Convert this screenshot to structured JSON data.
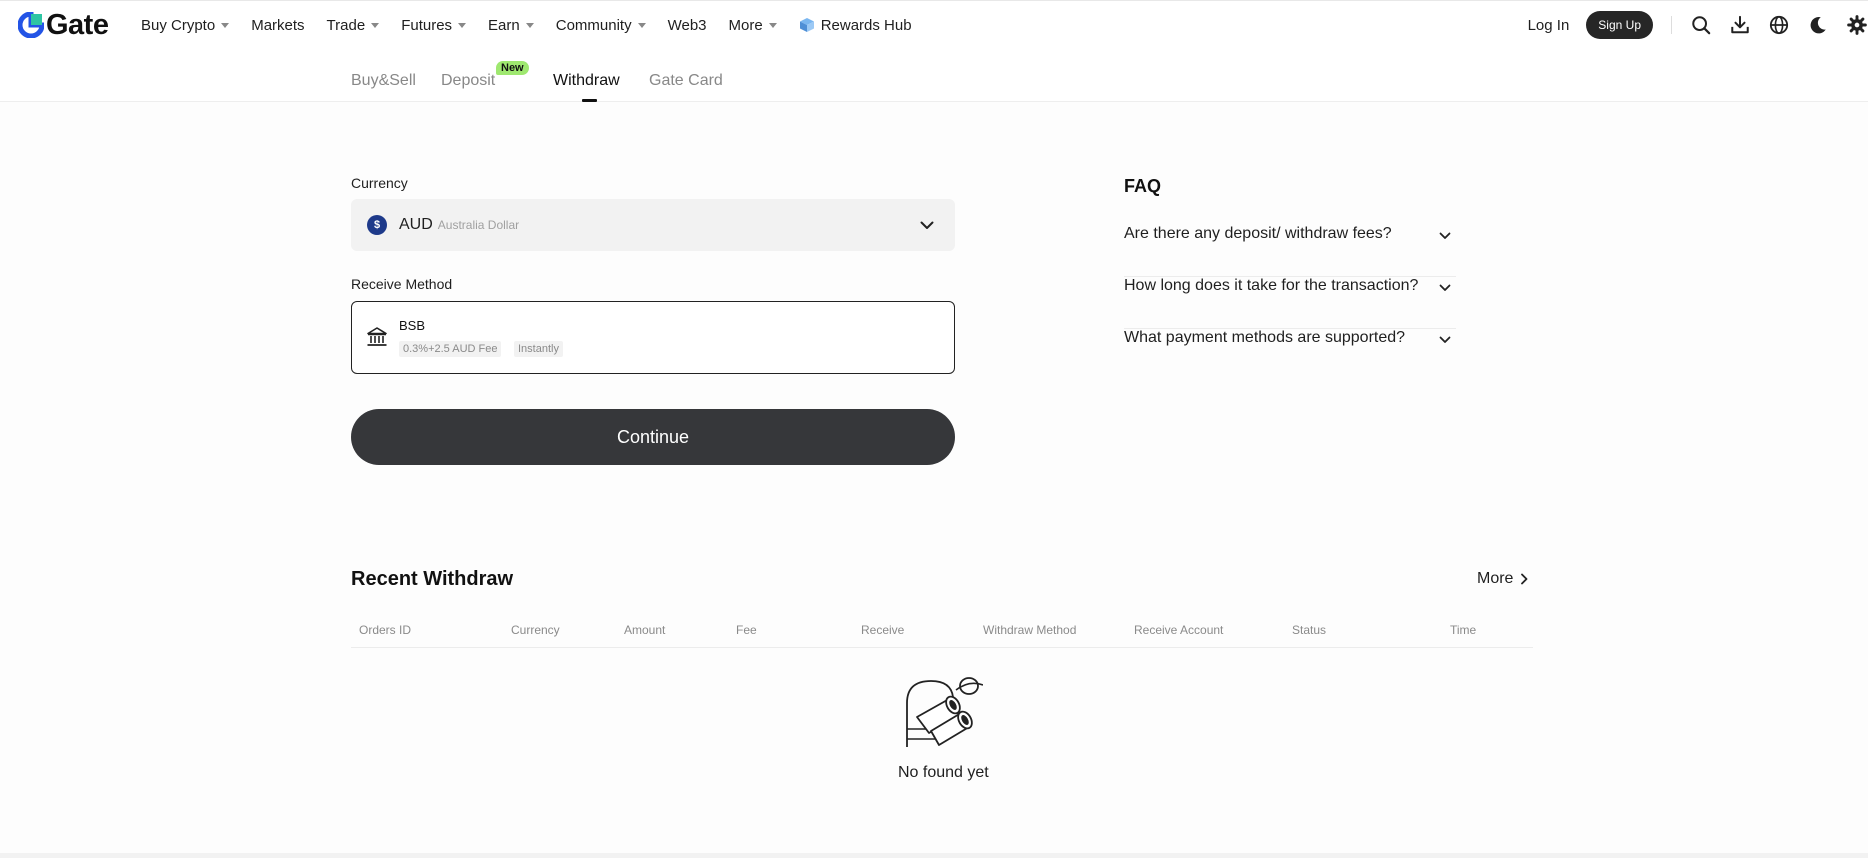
{
  "nav": {
    "logo_text": "Gate",
    "brand_color": "#2354e6",
    "items": [
      {
        "label": "Buy Crypto",
        "has_caret": true
      },
      {
        "label": "Markets",
        "has_caret": false
      },
      {
        "label": "Trade",
        "has_caret": true
      },
      {
        "label": "Futures",
        "has_caret": true
      },
      {
        "label": "Earn",
        "has_caret": true
      },
      {
        "label": "Community",
        "has_caret": true
      },
      {
        "label": "Web3",
        "has_caret": false
      },
      {
        "label": "More",
        "has_caret": true
      }
    ],
    "rewards_label": "Rewards Hub",
    "login_label": "Log In",
    "signup_label": "Sign Up",
    "icons": [
      "search-icon",
      "download-icon",
      "globe-icon",
      "moon-icon",
      "settings-icon"
    ]
  },
  "tabs": {
    "items": [
      {
        "label": "Buy&Sell",
        "active": false
      },
      {
        "label": "Deposit",
        "active": false
      },
      {
        "label": "Withdraw",
        "active": true
      },
      {
        "label": "Gate Card",
        "active": false
      }
    ],
    "new_badge": "New"
  },
  "form": {
    "currency_label": "Currency",
    "currency_code": "AUD",
    "currency_name": "Australia Dollar",
    "currency_symbol": "$",
    "receive_label": "Receive Method",
    "method_name": "BSB",
    "method_fee": "0.3%+2.5 AUD Fee",
    "method_speed": "Instantly",
    "continue_label": "Continue"
  },
  "faq": {
    "title": "FAQ",
    "questions": [
      "Are there any deposit/ withdraw fees?",
      "How long does it take for the transaction?",
      "What payment methods are supported?"
    ]
  },
  "recent": {
    "title": "Recent Withdraw",
    "more_label": "More",
    "columns": [
      "Orders ID",
      "Currency",
      "Amount",
      "Fee",
      "Receive",
      "Withdraw Method",
      "Receive Account",
      "Status",
      "Time"
    ],
    "rows": [],
    "empty_text": "No found yet"
  }
}
